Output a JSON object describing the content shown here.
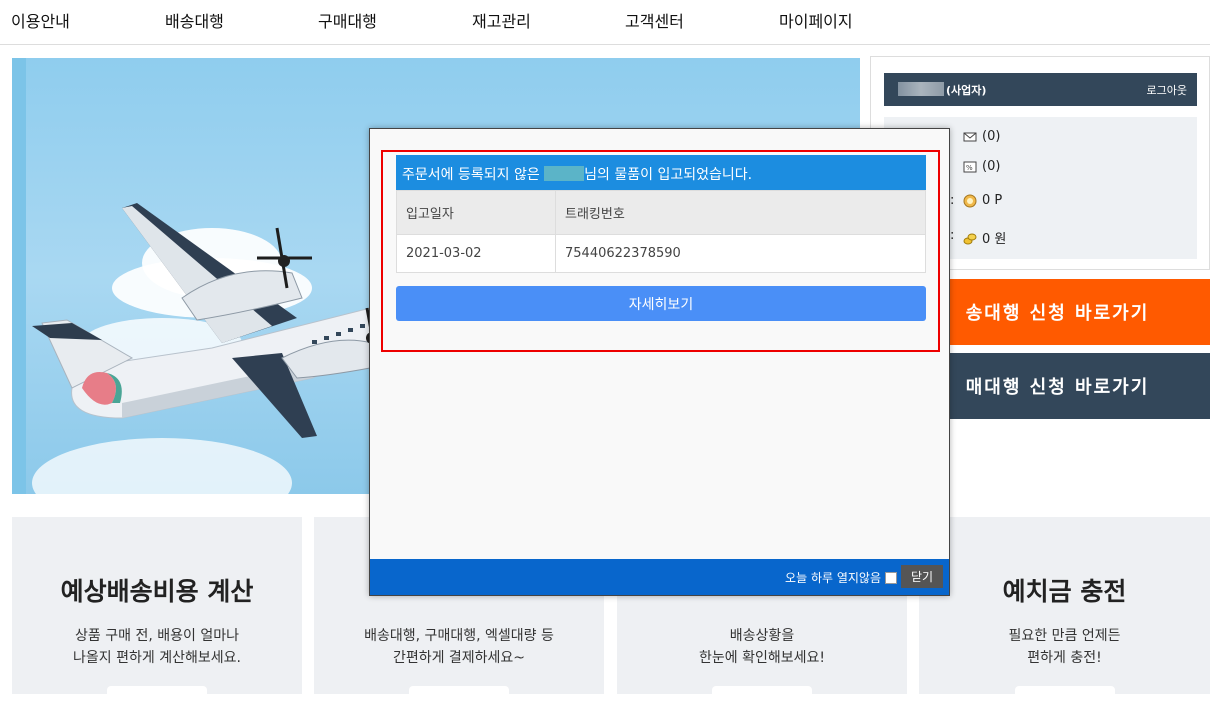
{
  "nav": {
    "items": [
      "이용안내",
      "배송대행",
      "구매대행",
      "재고관리",
      "고객센터",
      "마이페이지"
    ]
  },
  "side": {
    "role": "(사업자)",
    "logout": "로그아웃",
    "rows": [
      {
        "icon": "envelope-icon",
        "value": "(0)"
      },
      {
        "icon": "coupon-icon",
        "value": "(0)"
      },
      {
        "icon": "point-icon",
        "value": "0 P"
      },
      {
        "icon": "coins-icon",
        "value": "0 원"
      }
    ]
  },
  "buttons": {
    "shipping": "송대행 신청 바로가기",
    "purchase": "매대행 신청 바로가기"
  },
  "cards": [
    {
      "title": "예상배송비용 계산",
      "desc1": "상품 구매 전, 배용이 얼마나",
      "desc2": "나올지 편하게 계산해보세요."
    },
    {
      "title": "",
      "desc1": "배송대행, 구매대행, 엑셀대량 등",
      "desc2": "간편하게 결제하세요~"
    },
    {
      "title": "",
      "desc1": "배송상황을",
      "desc2": "한눈에 확인해보세요!"
    },
    {
      "title": "예치금 충전",
      "desc1": "필요한 만큼 언제든",
      "desc2": "편하게 충전!"
    }
  ],
  "modal": {
    "header_prefix": "주문서에 등록되지 않은",
    "header_suffix": "님의 물품이 입고되었습니다.",
    "columns": [
      "입고일자",
      "트래킹번호"
    ],
    "rows": [
      [
        "2021-03-02",
        "75440622378590"
      ]
    ],
    "detail_button": "자세히보기",
    "dont_show": "오늘 하루 열지않음",
    "close": "닫기"
  },
  "colors": {
    "accent_orange": "#ff5a00",
    "navy": "#33475a",
    "modal_blue": "#1c8de0",
    "footer_blue": "#0866cc"
  }
}
